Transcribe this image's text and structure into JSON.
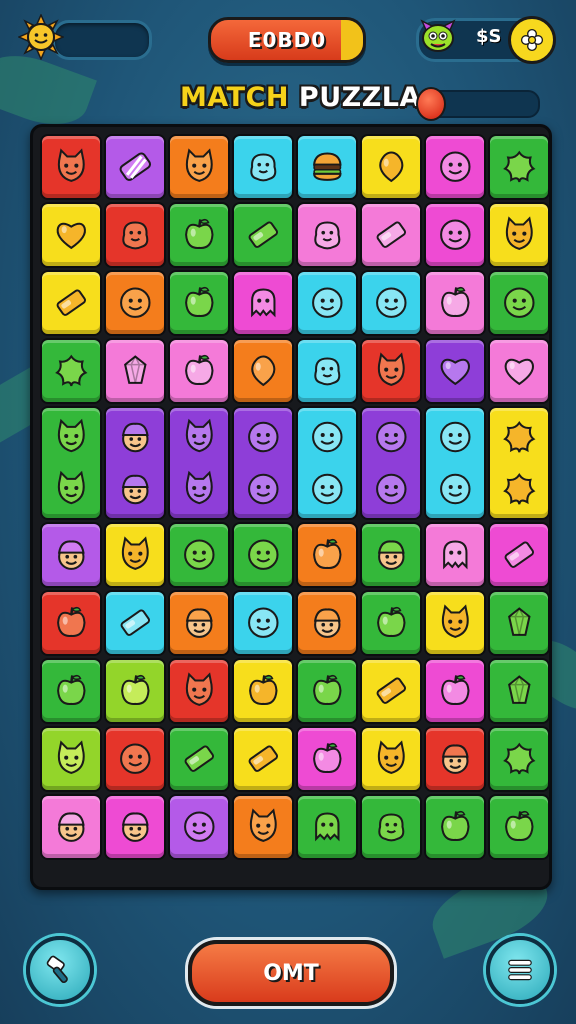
{
  "hud": {
    "score": "E0BD0",
    "coins": "$S"
  },
  "title": {
    "word1": "MATCH",
    "word2": "PUZZLA"
  },
  "level_progress": 0.05,
  "actions": {
    "bottom_label": "OMT"
  },
  "palette": {
    "red": "#e5352a",
    "purple": "#b45ae8",
    "orange": "#f47d1c",
    "cyan": "#3bd3ec",
    "yellow": "#f7de1c",
    "magenta": "#ee4bd3",
    "green": "#34b83a",
    "pink": "#f47ad8",
    "violet": "#8e3ed8",
    "lime": "#93d52a"
  },
  "board": {
    "columns": 8,
    "tiles": [
      {
        "c": "red",
        "i": "cat-face"
      },
      {
        "c": "purple",
        "i": "candy-stripes"
      },
      {
        "c": "orange",
        "i": "cat-face"
      },
      {
        "c": "cyan",
        "i": "blob-creature"
      },
      {
        "c": "cyan",
        "i": "burger"
      },
      {
        "c": "yellow",
        "i": "leaf-drop"
      },
      {
        "c": "magenta",
        "i": "smiley"
      },
      {
        "c": "green",
        "i": "leaf"
      },
      {
        "c": "yellow",
        "i": "heart"
      },
      {
        "c": "red",
        "i": "blob-creature"
      },
      {
        "c": "green",
        "i": "apple"
      },
      {
        "c": "green",
        "i": "candy-bar"
      },
      {
        "c": "pink",
        "i": "blob-creature"
      },
      {
        "c": "pink",
        "i": "candy-bar"
      },
      {
        "c": "magenta",
        "i": "smiley"
      },
      {
        "c": "yellow",
        "i": "cat-face"
      },
      {
        "c": "yellow",
        "i": "candy-bar"
      },
      {
        "c": "orange",
        "i": "smiley"
      },
      {
        "c": "green",
        "i": "apple"
      },
      {
        "c": "magenta",
        "i": "ghost"
      },
      {
        "c": "cyan",
        "i": "smiley"
      },
      {
        "c": "cyan",
        "i": "smiley"
      },
      {
        "c": "pink",
        "i": "apple"
      },
      {
        "c": "green",
        "i": "smiley"
      },
      {
        "c": "green",
        "i": "leaf"
      },
      {
        "c": "pink",
        "i": "gem"
      },
      {
        "c": "pink",
        "i": "apple"
      },
      {
        "c": "orange",
        "i": "leaf-drop"
      },
      {
        "c": "cyan",
        "i": "blob-creature"
      },
      {
        "c": "red",
        "i": "cat-face"
      },
      {
        "c": "violet",
        "i": "heart"
      },
      {
        "c": "pink",
        "i": "heart"
      },
      {
        "c": "green",
        "i": "cat-face",
        "t": true
      },
      {
        "c": "violet",
        "i": "boy-face",
        "t": true
      },
      {
        "c": "violet",
        "i": "cat-face",
        "t": true
      },
      {
        "c": "violet",
        "i": "smiley",
        "t": true
      },
      {
        "c": "cyan",
        "i": "smiley",
        "t": true
      },
      {
        "c": "violet",
        "i": "smiley",
        "t": true
      },
      {
        "c": "cyan",
        "i": "smiley",
        "t": true
      },
      {
        "c": "yellow",
        "i": "leaf",
        "t": true
      },
      {
        "c": "purple",
        "i": "boy-face"
      },
      {
        "c": "yellow",
        "i": "cat-face"
      },
      {
        "c": "green",
        "i": "smiley"
      },
      {
        "c": "green",
        "i": "smiley"
      },
      {
        "c": "orange",
        "i": "apple"
      },
      {
        "c": "green",
        "i": "boy-face"
      },
      {
        "c": "pink",
        "i": "ghost"
      },
      {
        "c": "magenta",
        "i": "candy-bar"
      },
      {
        "c": "red",
        "i": "apple"
      },
      {
        "c": "cyan",
        "i": "candy-bar"
      },
      {
        "c": "orange",
        "i": "boy-face"
      },
      {
        "c": "cyan",
        "i": "smiley"
      },
      {
        "c": "orange",
        "i": "boy-face"
      },
      {
        "c": "green",
        "i": "apple"
      },
      {
        "c": "yellow",
        "i": "cat-face"
      },
      {
        "c": "green",
        "i": "gem"
      },
      {
        "c": "green",
        "i": "apple"
      },
      {
        "c": "lime",
        "i": "apple"
      },
      {
        "c": "red",
        "i": "cat-face"
      },
      {
        "c": "yellow",
        "i": "apple"
      },
      {
        "c": "green",
        "i": "apple"
      },
      {
        "c": "yellow",
        "i": "candy-bar"
      },
      {
        "c": "magenta",
        "i": "apple"
      },
      {
        "c": "green",
        "i": "gem"
      },
      {
        "c": "lime",
        "i": "cat-face"
      },
      {
        "c": "red",
        "i": "smiley"
      },
      {
        "c": "green",
        "i": "candy-bar"
      },
      {
        "c": "yellow",
        "i": "candy-bar"
      },
      {
        "c": "magenta",
        "i": "apple"
      },
      {
        "c": "yellow",
        "i": "cat-face"
      },
      {
        "c": "red",
        "i": "boy-face"
      },
      {
        "c": "green",
        "i": "leaf"
      },
      {
        "c": "pink",
        "i": "boy-face"
      },
      {
        "c": "magenta",
        "i": "boy-face"
      },
      {
        "c": "purple",
        "i": "smiley"
      },
      {
        "c": "orange",
        "i": "cat-face"
      },
      {
        "c": "green",
        "i": "ghost"
      },
      {
        "c": "green",
        "i": "blob-creature"
      },
      {
        "c": "green",
        "i": "apple"
      },
      {
        "c": "green",
        "i": "apple"
      }
    ]
  }
}
